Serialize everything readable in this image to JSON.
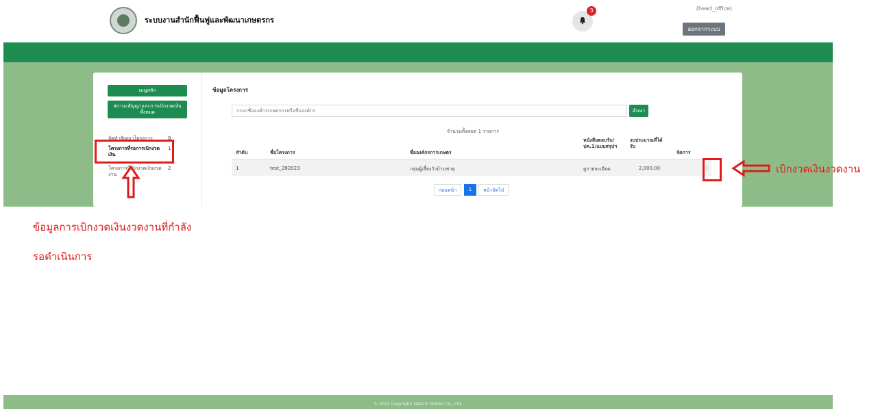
{
  "header": {
    "site_title": "ระบบงานสำนักฟื้นฟูและพัฒนาเกษตรกร",
    "notification_count": "3",
    "user_name": "(head_office)",
    "logout_label": "ออกจากระบบ",
    "logo_icon": "emblem-logo-icon",
    "bell_icon": "bell-icon"
  },
  "sidebar": {
    "main_menu_label": "เมนูหลัก",
    "contract_status_label": "สถานะสัญญาและการเบิกงวดเงินทั้งหมด",
    "items": [
      {
        "label": "จัดทำสัญญาโครงการ",
        "count": "0"
      },
      {
        "label": "โครงการที่รอการเบิกงวดเงิน",
        "count": "1"
      },
      {
        "label": "โครงการที่เบิกงวดเงินงวดงาน",
        "count": "2"
      }
    ]
  },
  "main": {
    "section_title": "ข้อมูลโครงการ",
    "search_placeholder": "กรอกชื่อองค์กรเกษตรกรหรือชื่อองค์กร",
    "search_button": "ค้นหา",
    "total_text": "จำนวนทั้งหมด 1 รายการ",
    "table": {
      "headers": [
        "ลำดับ",
        "ชื่อโครงการ",
        "ชื่อองค์กรการเกษตร",
        "หนังสือตอบรับ/ ปค.1/แบบสรุปฯ",
        "งบประมาณที่ได้ รับ",
        "จัดการ"
      ],
      "rows": [
        {
          "no": "1",
          "project_name": "test_282023",
          "org_name": "กลุ่มผู้เลี้ยงวัวบ้านชาตุ",
          "document": "ดูรายละเอียด",
          "budget": "2,000.00",
          "action": "1"
        }
      ]
    },
    "pagination": {
      "prev": "ก่อนหน้า",
      "current": "1",
      "next": "หน้าถัดไป"
    }
  },
  "footer": {
    "copyright": "© 2022 Copyright: Data In Motion Co., Ltd."
  },
  "annotations": {
    "right_label": "เบิกงวดเงินงวดงาน",
    "bottom_line1": "ข้อมูลการเบิกงวดเงินงวดงานที่กำลัง",
    "bottom_line2": "รอดำเนินการ",
    "color": "#e31a1a"
  },
  "colors": {
    "primary_green": "#1e8c50",
    "light_green": "#8ebc89",
    "annotation_red": "#e31a1a",
    "badge_red": "#d9252a"
  }
}
